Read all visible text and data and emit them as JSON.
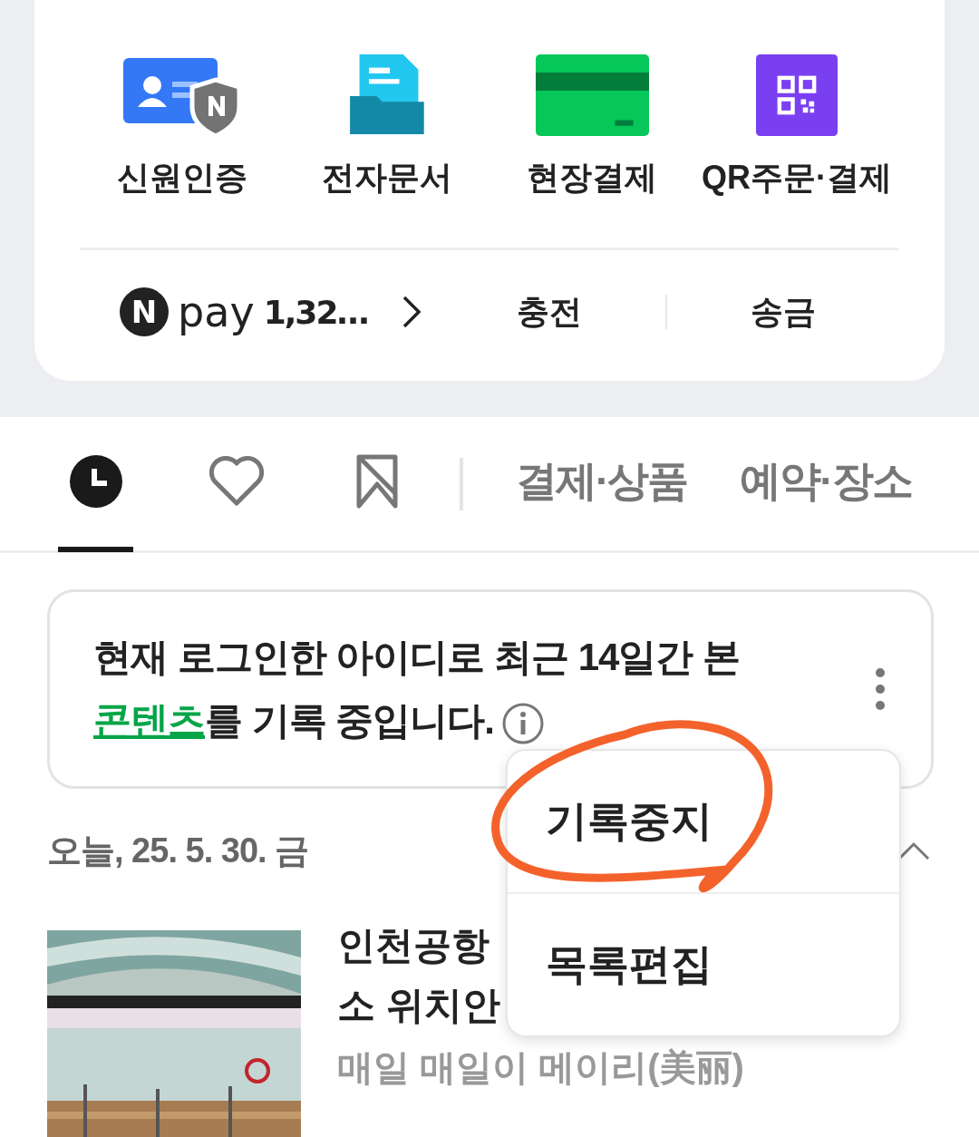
{
  "shortcuts": [
    {
      "kind": "id",
      "label": "신원인증"
    },
    {
      "kind": "doc",
      "label": "전자문서"
    },
    {
      "kind": "card",
      "label": "현장결제"
    },
    {
      "kind": "qr",
      "label": "QR주문·결제"
    }
  ],
  "pay": {
    "brand": "N",
    "name": "pay",
    "balance": "1,32…",
    "actions": [
      "충전",
      "송금"
    ]
  },
  "tabs": [
    {
      "kind": "clock",
      "selected": true
    },
    {
      "kind": "heart",
      "selected": false
    },
    {
      "kind": "bookmark",
      "selected": false
    },
    {
      "kind": "text",
      "label": "결제·상품",
      "selected": false
    },
    {
      "kind": "text",
      "label": "예약·장소",
      "selected": false
    }
  ],
  "notice": {
    "text": "현재 로그인한 아이디로 최근 14일간 본",
    "link": "콘텐츠",
    "text_after": "를 기록 중입니다."
  },
  "date_heading": "오늘, 25. 5. 30. 금",
  "expanded": true,
  "item": {
    "title_lines": [
      "인천공항",
      "소 위치안"
    ],
    "source": "매일 매일이 메이리(美丽)"
  },
  "menu": {
    "items": [
      "기록중지",
      "목록편집"
    ]
  }
}
